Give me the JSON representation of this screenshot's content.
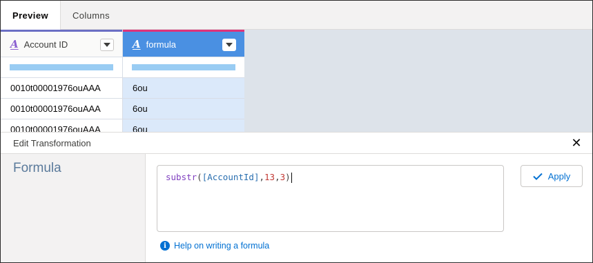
{
  "tabs": [
    {
      "label": "Preview",
      "active": true
    },
    {
      "label": "Columns",
      "active": false
    }
  ],
  "grid": {
    "columns": [
      {
        "name": "Account ID",
        "type_icon": "text-type-icon",
        "accent_color": "#6b6fc4"
      },
      {
        "name": "formula",
        "type_icon": "text-type-icon",
        "accent_color": "#e0337a"
      }
    ],
    "rows": [
      [
        "0010t00001976ouAAA",
        "6ou"
      ],
      [
        "0010t00001976ouAAA",
        "6ou"
      ],
      [
        "0010t00001976ouAAA",
        "6ou"
      ]
    ]
  },
  "panel": {
    "title": "Edit Transformation",
    "section_title": "Formula",
    "formula": {
      "fn": "substr",
      "open": "(",
      "field": "[AccountId]",
      "comma1": ",",
      "arg1": "13",
      "comma2": ",",
      "arg2": "3",
      "close": ")"
    },
    "apply_label": "Apply",
    "help_link": "Help on writing a formula"
  },
  "colors": {
    "selected_column_header": "#4a90e2",
    "selected_column_bg": "#dbe9fa",
    "link": "#0070d2"
  }
}
